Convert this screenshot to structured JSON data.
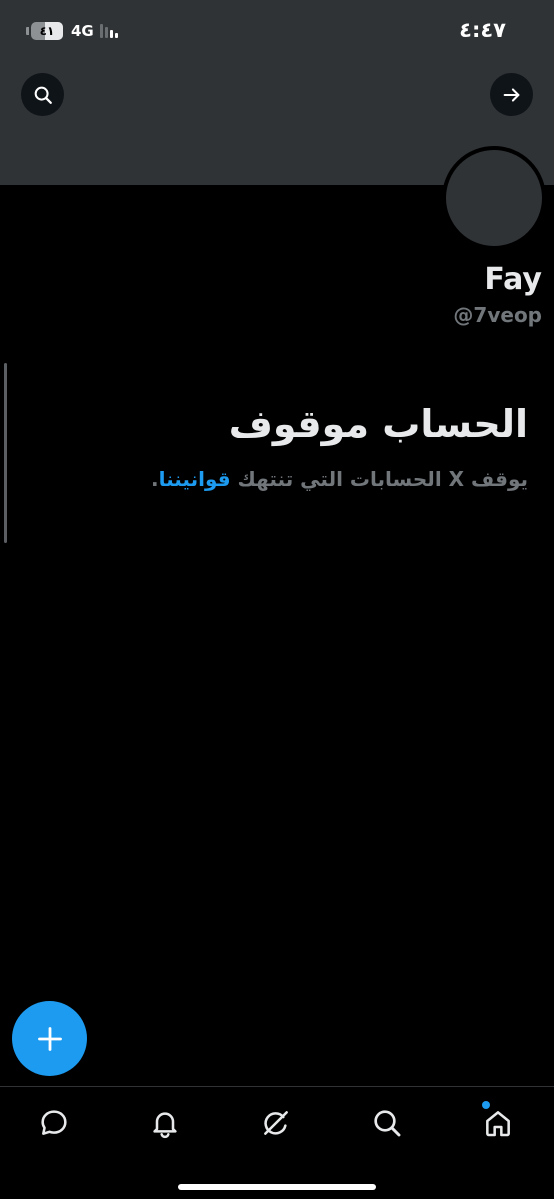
{
  "status_bar": {
    "time": "٤:٤٧",
    "battery_level": "٤١",
    "network": "4G"
  },
  "profile": {
    "display_name": "Fay",
    "handle": "@7veop"
  },
  "suspension": {
    "title": "الحساب موقوف",
    "description_prefix": "يوقف X الحسابات التي تنتهك ",
    "rules_link": "قوانيننا",
    "description_suffix": "."
  },
  "icons": {
    "search": "search-icon",
    "forward": "arrow-right-icon",
    "compose": "plus-icon",
    "messages": "message-bubble-icon",
    "notifications": "bell-icon",
    "grok": "grok-icon",
    "explore": "magnifier-icon",
    "home": "home-icon"
  },
  "colors": {
    "accent": "#1d9bf0",
    "banner": "#2f3336",
    "background": "#000000",
    "secondary_text": "#71767b"
  }
}
